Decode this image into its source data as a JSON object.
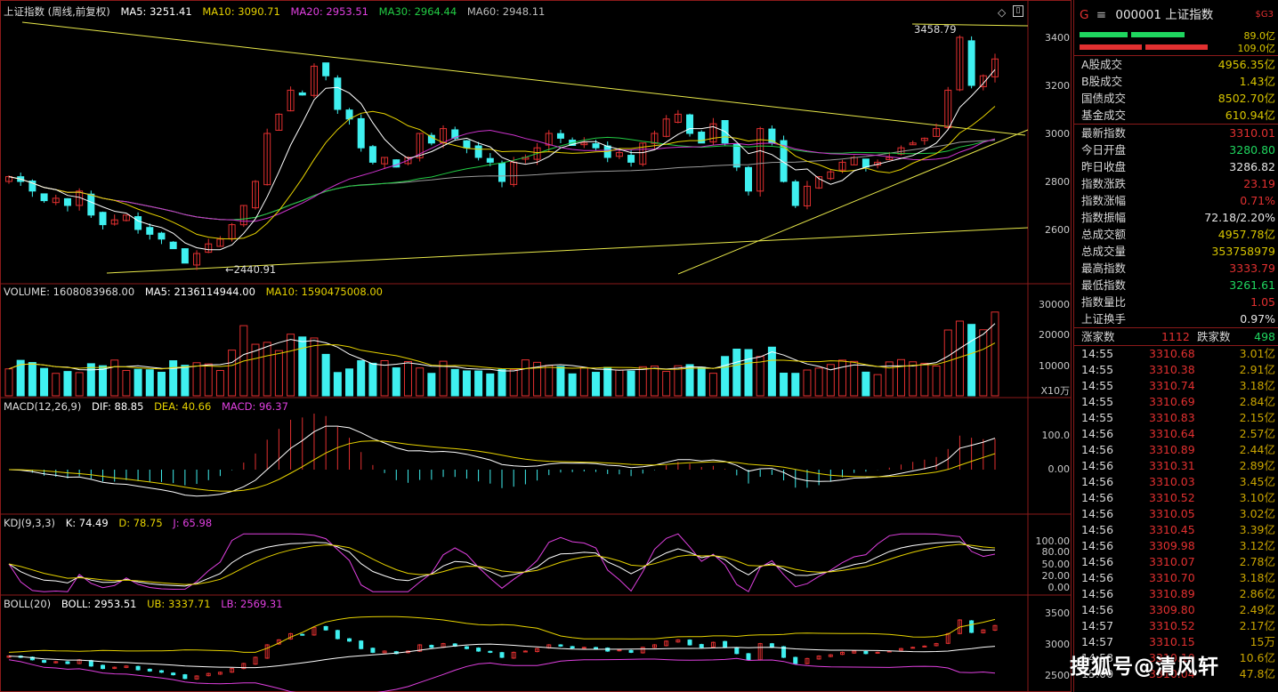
{
  "main_pane": {
    "title": "上证指数 (周线,前复权)",
    "ma5": "MA5: 3251.41",
    "ma10": "MA10: 3090.71",
    "ma20": "MA20: 2953.51",
    "ma30": "MA30: 2964.44",
    "ma60": "MA60: 2948.11",
    "high_label": "3458.79",
    "low_label": "2440.91",
    "y_labels": [
      "3400",
      "3200",
      "3000",
      "2800",
      "2600"
    ]
  },
  "volume_pane": {
    "title": "VOLUME: 1608083968.00",
    "ma5": "MA5: 2136114944.00",
    "ma10": "MA10: 1590475008.00",
    "y_labels": [
      "30000",
      "20000",
      "10000"
    ],
    "unit": "X10万"
  },
  "macd_pane": {
    "title": "MACD(12,26,9)",
    "dif": "DIF: 88.85",
    "dea": "DEA: 40.66",
    "macd": "MACD: 96.37",
    "y_labels": [
      "100.0",
      "0.00"
    ]
  },
  "kdj_pane": {
    "title": "KDJ(9,3,3)",
    "k": "K: 74.49",
    "d": "D: 78.75",
    "j": "J: 65.98",
    "y_labels": [
      "100.00",
      "80.00",
      "50.00",
      "20.00",
      "0.00"
    ]
  },
  "boll_pane": {
    "title": "BOLL(20)",
    "boll": "BOLL: 2953.51",
    "ub": "UB: 3337.71",
    "lb": "LB: 2569.31",
    "y_labels": [
      "3500",
      "3000",
      "2500"
    ]
  },
  "chart_data": {
    "type": "candlestick",
    "title": "上证指数 (周线,前复权)",
    "close": [
      2820,
      2800,
      2760,
      2720,
      2730,
      2700,
      2760,
      2660,
      2620,
      2640,
      2660,
      2600,
      2580,
      2560,
      2520,
      2460,
      2500,
      2540,
      2560,
      2620,
      2700,
      2800,
      3000,
      3080,
      3180,
      3160,
      3280,
      3240,
      3100,
      3060,
      2940,
      2880,
      2900,
      2860,
      2900,
      3000,
      2960,
      3020,
      2980,
      2940,
      2900,
      2880,
      2800,
      2880,
      2900,
      2940,
      3000,
      2980,
      2950,
      2960,
      2940,
      2900,
      2920,
      2880,
      2960,
      3000,
      3060,
      3080,
      3000,
      2960,
      3040,
      2960,
      2860,
      2760,
      3020,
      2960,
      2800,
      2700,
      2780,
      2820,
      2840,
      2880,
      2900,
      2860,
      2880,
      2900,
      2940,
      2960,
      2980,
      3020,
      3180,
      3400,
      3200,
      3240,
      3310
    ]
  },
  "sidebar": {
    "code_name": "000001 上证指数",
    "g_mark": "G",
    "menu_mark": "≡",
    "sg_mark": "$G3",
    "bar_top_value": "89.0亿",
    "bar_bottom_value": "109.0亿",
    "rows1": [
      {
        "k": "A股成交",
        "v": "4956.35亿",
        "c": "yellow"
      },
      {
        "k": "B股成交",
        "v": "1.43亿",
        "c": "yellow"
      },
      {
        "k": "国债成交",
        "v": "8502.70亿",
        "c": "yellow"
      },
      {
        "k": "基金成交",
        "v": "610.94亿",
        "c": "yellow"
      }
    ],
    "rows2": [
      {
        "k": "最新指数",
        "v": "3310.01",
        "c": "red"
      },
      {
        "k": "今日开盘",
        "v": "3280.80",
        "c": "green"
      },
      {
        "k": "昨日收盘",
        "v": "3286.82",
        "c": "white"
      },
      {
        "k": "指数涨跌",
        "v": "23.19",
        "c": "red"
      },
      {
        "k": "指数涨幅",
        "v": "0.71%",
        "c": "red"
      },
      {
        "k": "指数振幅",
        "v": "72.18/2.20%",
        "c": "white"
      },
      {
        "k": "总成交额",
        "v": "4957.78亿",
        "c": "yellow"
      },
      {
        "k": "总成交量",
        "v": "353758979",
        "c": "yellow"
      },
      {
        "k": "最高指数",
        "v": "3333.79",
        "c": "red"
      },
      {
        "k": "最低指数",
        "v": "3261.61",
        "c": "green"
      },
      {
        "k": "指数量比",
        "v": "1.05",
        "c": "red"
      },
      {
        "k": "上证换手",
        "v": "0.97%",
        "c": "white"
      }
    ],
    "up_label": "涨家数",
    "up_count": "1112",
    "down_label": "跌家数",
    "down_count": "498",
    "ticks": [
      {
        "t": "14:55",
        "p": "3310.68",
        "q": "3.01亿"
      },
      {
        "t": "14:55",
        "p": "3310.38",
        "q": "2.91亿"
      },
      {
        "t": "14:55",
        "p": "3310.74",
        "q": "3.18亿"
      },
      {
        "t": "14:55",
        "p": "3310.69",
        "q": "2.84亿"
      },
      {
        "t": "14:55",
        "p": "3310.83",
        "q": "2.15亿"
      },
      {
        "t": "14:56",
        "p": "3310.64",
        "q": "2.57亿"
      },
      {
        "t": "14:56",
        "p": "3310.89",
        "q": "2.44亿"
      },
      {
        "t": "14:56",
        "p": "3310.31",
        "q": "2.89亿"
      },
      {
        "t": "14:56",
        "p": "3310.03",
        "q": "3.45亿"
      },
      {
        "t": "14:56",
        "p": "3310.52",
        "q": "3.10亿"
      },
      {
        "t": "14:56",
        "p": "3310.05",
        "q": "3.02亿"
      },
      {
        "t": "14:56",
        "p": "3310.45",
        "q": "3.39亿"
      },
      {
        "t": "14:56",
        "p": "3309.98",
        "q": "3.12亿"
      },
      {
        "t": "14:56",
        "p": "3310.07",
        "q": "2.78亿"
      },
      {
        "t": "14:56",
        "p": "3310.70",
        "q": "3.18亿"
      },
      {
        "t": "14:56",
        "p": "3310.89",
        "q": "2.86亿"
      },
      {
        "t": "14:56",
        "p": "3309.80",
        "q": "2.49亿"
      },
      {
        "t": "14:57",
        "p": "3310.52",
        "q": "2.17亿"
      },
      {
        "t": "14:57",
        "p": "3310.15",
        "q": "15万"
      },
      {
        "t": "14:58",
        "p": "3310.10",
        "q": "10.6亿"
      },
      {
        "t": "15:00",
        "p": "3310.04",
        "q": "47.8亿"
      }
    ]
  },
  "watermark": "搜狐号@清风轩",
  "colors": {
    "up": "#e23030",
    "down": "#3ff0f0",
    "ma5": "#ffffff",
    "ma10": "#e6d200",
    "ma20": "#cc33cc",
    "ma30": "#22cc44",
    "ma60": "#9a9a9a",
    "trend": "#e8e84a"
  }
}
